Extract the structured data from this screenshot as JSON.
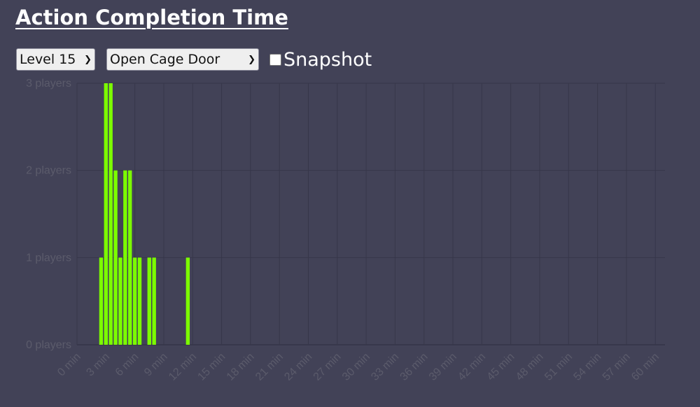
{
  "title": "Action Completion Time",
  "controls": {
    "level_select": "Level 15",
    "action_select": "Open Cage Door",
    "snapshot_label": "Snapshot",
    "snapshot_checked": false
  },
  "chart_data": {
    "type": "bar",
    "bar_color": "#7cfc00",
    "grid_color": "#37374a",
    "y_ticks": [
      {
        "value": 0,
        "label": "0 players"
      },
      {
        "value": 1,
        "label": "1 players"
      },
      {
        "value": 2,
        "label": "2 players"
      },
      {
        "value": 3,
        "label": "3 players"
      }
    ],
    "x_ticks": [
      "0 min",
      "3 min",
      "6 min",
      "9 min",
      "12 min",
      "15 min",
      "18 min",
      "21 min",
      "24 min",
      "27 min",
      "30 min",
      "33 min",
      "36 min",
      "39 min",
      "42 min",
      "45 min",
      "48 min",
      "51 min",
      "54 min",
      "57 min",
      "60 min"
    ],
    "ylim": [
      0,
      3
    ],
    "xlim": [
      0,
      61
    ],
    "bin_width_min": 0.5,
    "bars": [
      {
        "x": 2.5,
        "y": 1
      },
      {
        "x": 3.0,
        "y": 3
      },
      {
        "x": 3.5,
        "y": 3
      },
      {
        "x": 4.0,
        "y": 2
      },
      {
        "x": 4.5,
        "y": 1
      },
      {
        "x": 5.0,
        "y": 2
      },
      {
        "x": 5.5,
        "y": 2
      },
      {
        "x": 6.0,
        "y": 1
      },
      {
        "x": 6.5,
        "y": 1
      },
      {
        "x": 7.5,
        "y": 1
      },
      {
        "x": 8.0,
        "y": 1
      },
      {
        "x": 11.5,
        "y": 1
      }
    ]
  }
}
